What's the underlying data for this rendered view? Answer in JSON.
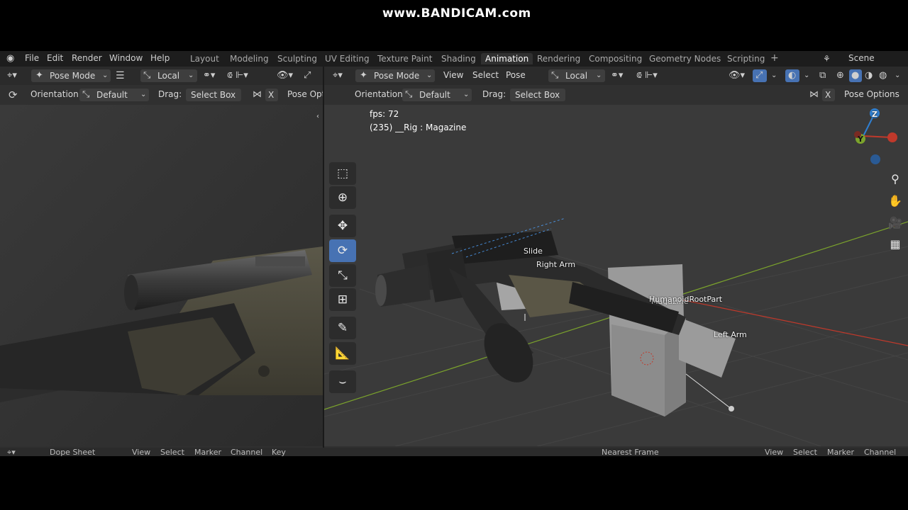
{
  "watermark": "www.BANDICAM.com",
  "menu": [
    "File",
    "Edit",
    "Render",
    "Window",
    "Help"
  ],
  "workspaces": [
    "Layout",
    "Modeling",
    "Sculpting",
    "UV Editing",
    "Texture Paint",
    "Shading",
    "Animation",
    "Rendering",
    "Compositing",
    "Geometry Nodes",
    "Scripting"
  ],
  "active_workspace": "Animation",
  "add_workspace": "+",
  "scene": "Scene",
  "left_header": {
    "mode": "Pose Mode",
    "transform": "Local",
    "orientation_label": "Orientation:",
    "orientation_value": "Default",
    "drag_label": "Drag:",
    "drag_value": "Select Box",
    "x_label": "X",
    "pose_options": "Pose Opti"
  },
  "right_header": {
    "mode": "Pose Mode",
    "menus": [
      "View",
      "Select",
      "Pose"
    ],
    "transform": "Local",
    "orientation_label": "Orientation:",
    "orientation_value": "Default",
    "drag_label": "Drag:",
    "drag_value": "Select Box",
    "x_label": "X",
    "pose_options": "Pose Options"
  },
  "viewport_info": {
    "fps": "fps: 72",
    "object": "(235) __Rig : Magazine"
  },
  "gizmo": {
    "z": "Z",
    "y": "Y"
  },
  "bones": {
    "slide": "Slide",
    "right_arm": "Right Arm",
    "root": "HumanoidRootPart",
    "magazine": "Magazine",
    "left_arm": "Left Arm"
  },
  "bottom": {
    "editor": "Dope Sheet",
    "menus": [
      "View",
      "Select",
      "Marker",
      "Channel",
      "Key"
    ],
    "snap": "Nearest Frame",
    "right_menus": [
      "View",
      "Select",
      "Marker",
      "Channel"
    ]
  },
  "colors": {
    "active": "#4772b3",
    "x_axis": "#c0392b",
    "y_axis": "#7ba32c",
    "z_axis": "#2f7fd1"
  }
}
